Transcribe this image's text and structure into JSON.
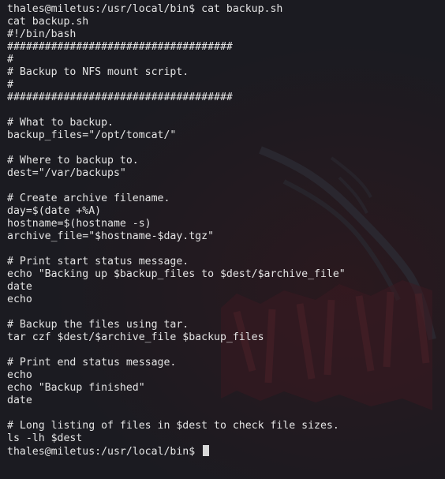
{
  "terminal": {
    "lines": [
      "thales@miletus:/usr/local/bin$ cat backup.sh",
      "cat backup.sh",
      "#!/bin/bash",
      "####################################",
      "#",
      "# Backup to NFS mount script.",
      "#",
      "####################################",
      "",
      "# What to backup.",
      "backup_files=\"/opt/tomcat/\"",
      "",
      "# Where to backup to.",
      "dest=\"/var/backups\"",
      "",
      "# Create archive filename.",
      "day=$(date +%A)",
      "hostname=$(hostname -s)",
      "archive_file=\"$hostname-$day.tgz\"",
      "",
      "# Print start status message.",
      "echo \"Backing up $backup_files to $dest/$archive_file\"",
      "date",
      "echo",
      "",
      "# Backup the files using tar.",
      "tar czf $dest/$archive_file $backup_files",
      "",
      "# Print end status message.",
      "echo",
      "echo \"Backup finished\"",
      "date",
      "",
      "# Long listing of files in $dest to check file sizes.",
      "ls -lh $dest"
    ],
    "prompt": "thales@miletus:/usr/local/bin$ ",
    "colors": {
      "background": "#1b1b21",
      "foreground": "#e4e4e4",
      "cursor": "#d8d8d8"
    }
  }
}
